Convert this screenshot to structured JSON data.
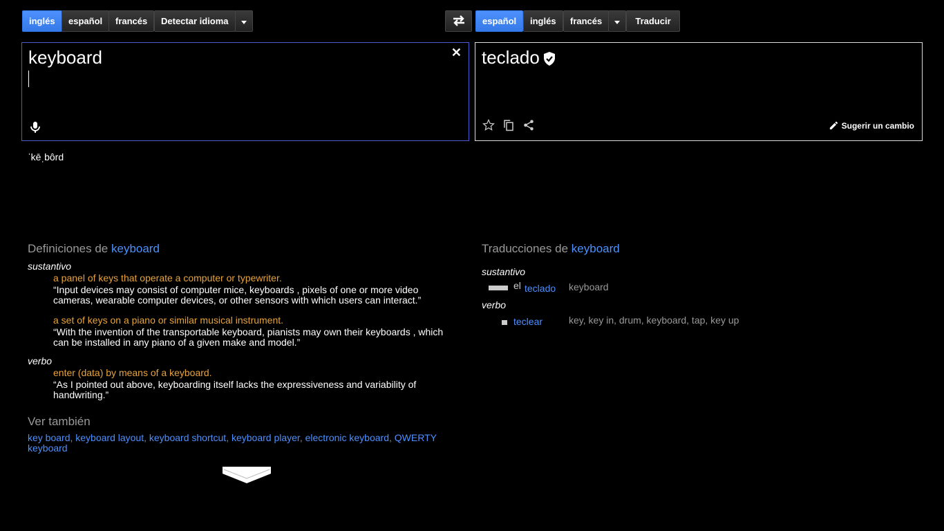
{
  "source_langs": [
    "inglés",
    "español",
    "francés",
    "Detectar idioma"
  ],
  "target_langs": [
    "español",
    "inglés",
    "francés"
  ],
  "translate_label": "Traducir",
  "source_text": "keyboard",
  "target_text": "teclado",
  "suggest_label": "Sugerir un cambio",
  "pronunciation": "ˈkēˌbôrd",
  "definitions": {
    "title_prefix": "Definiciones de",
    "keyword": "keyboard",
    "noun_label": "sustantivo",
    "noun_entries": [
      {
        "gloss": "a panel of keys that operate a computer or typewriter.",
        "example": "“Input devices may consist of computer mice, keyboards , pixels of one or more video cameras, wearable computer devices, or other sensors with which users can interact.”"
      },
      {
        "gloss": "a set of keys on a piano or similar musical instrument.",
        "example": "“With the invention of the transportable keyboard, pianists may own their keyboards , which can be installed in any piano of a given make and model.”"
      }
    ],
    "verb_label": "verbo",
    "verb_entries": [
      {
        "gloss": "enter (data) by means of a keyboard.",
        "example": "“As I pointed out above, keyboarding itself lacks the expressiveness and variability of handwriting.”"
      }
    ]
  },
  "see_also": {
    "title": "Ver también",
    "items": [
      "key board",
      "keyboard layout",
      "keyboard shortcut",
      "keyboard player",
      "electronic keyboard",
      "QWERTY keyboard"
    ]
  },
  "translations": {
    "title_prefix": "Traducciones de",
    "keyword": "keyboard",
    "noun_label": "sustantivo",
    "noun_rows": [
      {
        "article": "el",
        "word": "teclado",
        "synonyms": "keyboard",
        "frequency": 1.0
      }
    ],
    "verb_label": "verbo",
    "verb_rows": [
      {
        "word": "teclear",
        "synonyms": "key, key in, drum, keyboard, tap, key up",
        "frequency": 0.3
      }
    ]
  },
  "icons": {
    "swap": "swap-icon",
    "close": "close-icon",
    "mic": "microphone-icon",
    "verified": "verified-shield-icon",
    "star": "star-icon",
    "copy": "copy-icon",
    "share": "share-icon",
    "pencil": "pencil-icon",
    "more": "chevron-down-icon"
  },
  "colors": {
    "accent": "#4d90fe",
    "gloss": "#e8a33c",
    "background": "#000000"
  }
}
